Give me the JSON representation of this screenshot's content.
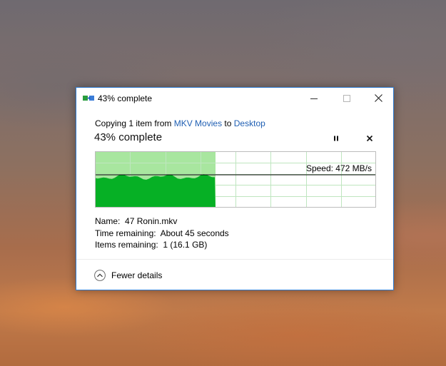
{
  "window": {
    "title": "43% complete",
    "icon": "copy-files-icon",
    "controls": [
      "minimize-icon",
      "maximize-icon",
      "close-icon"
    ]
  },
  "copy_info": {
    "prefix": "Copying 1 item from ",
    "source": "MKV Movies",
    "middle": " to ",
    "destination": "Desktop"
  },
  "status": {
    "percent_text": "43% complete",
    "progress_fraction": 0.43,
    "pause_icon": "pause-icon",
    "stop_icon": "stop-icon"
  },
  "speed_graph": {
    "speed_text": "Speed: 472 MB/s",
    "current_speed_mbps": 472,
    "colors": {
      "fill_dark": "#06b025",
      "fill_light": "#a8e69f",
      "grid": "#bfe6c0",
      "border": "#bcbcbc",
      "speed_line": "#000000"
    }
  },
  "details": {
    "name_label": "Name:",
    "name_value": "47 Ronin.mkv",
    "time_label": "Time remaining:",
    "time_value": "About 45 seconds",
    "items_label": "Items remaining:",
    "items_value": "1 (16.1 GB)"
  },
  "footer": {
    "toggle_label": "Fewer details",
    "toggle_icon": "chevron-up-icon"
  },
  "colors": {
    "accent_border": "#2d7bd1",
    "link": "#1f5fb3"
  }
}
